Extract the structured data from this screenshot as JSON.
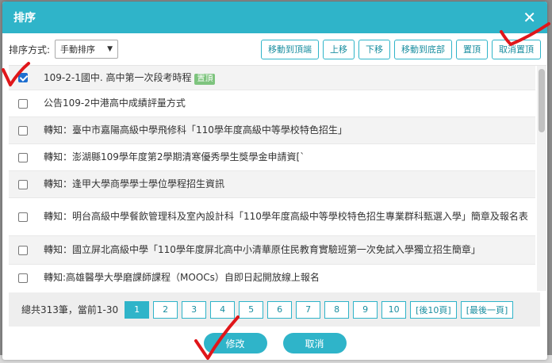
{
  "dialog": {
    "title": "排序",
    "close_glyph": "✕"
  },
  "toolbar": {
    "sort_label": "排序方式:",
    "sort_value": "手動排序",
    "buttons": [
      "移動到頂端",
      "上移",
      "下移",
      "移動到底部",
      "置頂",
      "取消置頂"
    ]
  },
  "items": [
    {
      "text": "109-2-1國中. 高中第一次段考時程",
      "badge": "置頂",
      "checked": true
    },
    {
      "text": "公告109-2中港高中成績評量方式",
      "checked": false
    },
    {
      "text": "轉知：臺中市嘉陽高級中學飛修科「110學年度高級中等學校特色招生」",
      "checked": false
    },
    {
      "text": "轉知：澎湖縣109學年度第2學期清寒優秀學生獎學金申請資[`",
      "checked": false
    },
    {
      "text": "轉知：逢甲大學商學學士學位學程招生資訊",
      "checked": false
    },
    {
      "text": "轉知：明台高級中學餐飲管理科及室內設計科「110學年度高級中等學校特色招生專業群科甄選入學」簡章及報名表",
      "checked": false
    },
    {
      "text": "轉知：國立屏北高級中學「110學年度屏北高中小清華原住民教育實驗班第一次免試入學獨立招生簡章」",
      "checked": false
    },
    {
      "text": "轉知:高雄醫學大學磨課師課程（MOOCs）自即日起開放線上報名",
      "checked": false
    }
  ],
  "pager": {
    "summary": "總共313筆，當前1-30",
    "pages": [
      "1",
      "2",
      "3",
      "4",
      "5",
      "6",
      "7",
      "8",
      "9",
      "10",
      "[後10頁]",
      "[最後一頁]"
    ],
    "active_page": "1"
  },
  "footer": {
    "confirm_label": "修改",
    "cancel_label": "取消"
  },
  "colors": {
    "accent": "#2fb4c9",
    "mark": "#e0161a"
  }
}
